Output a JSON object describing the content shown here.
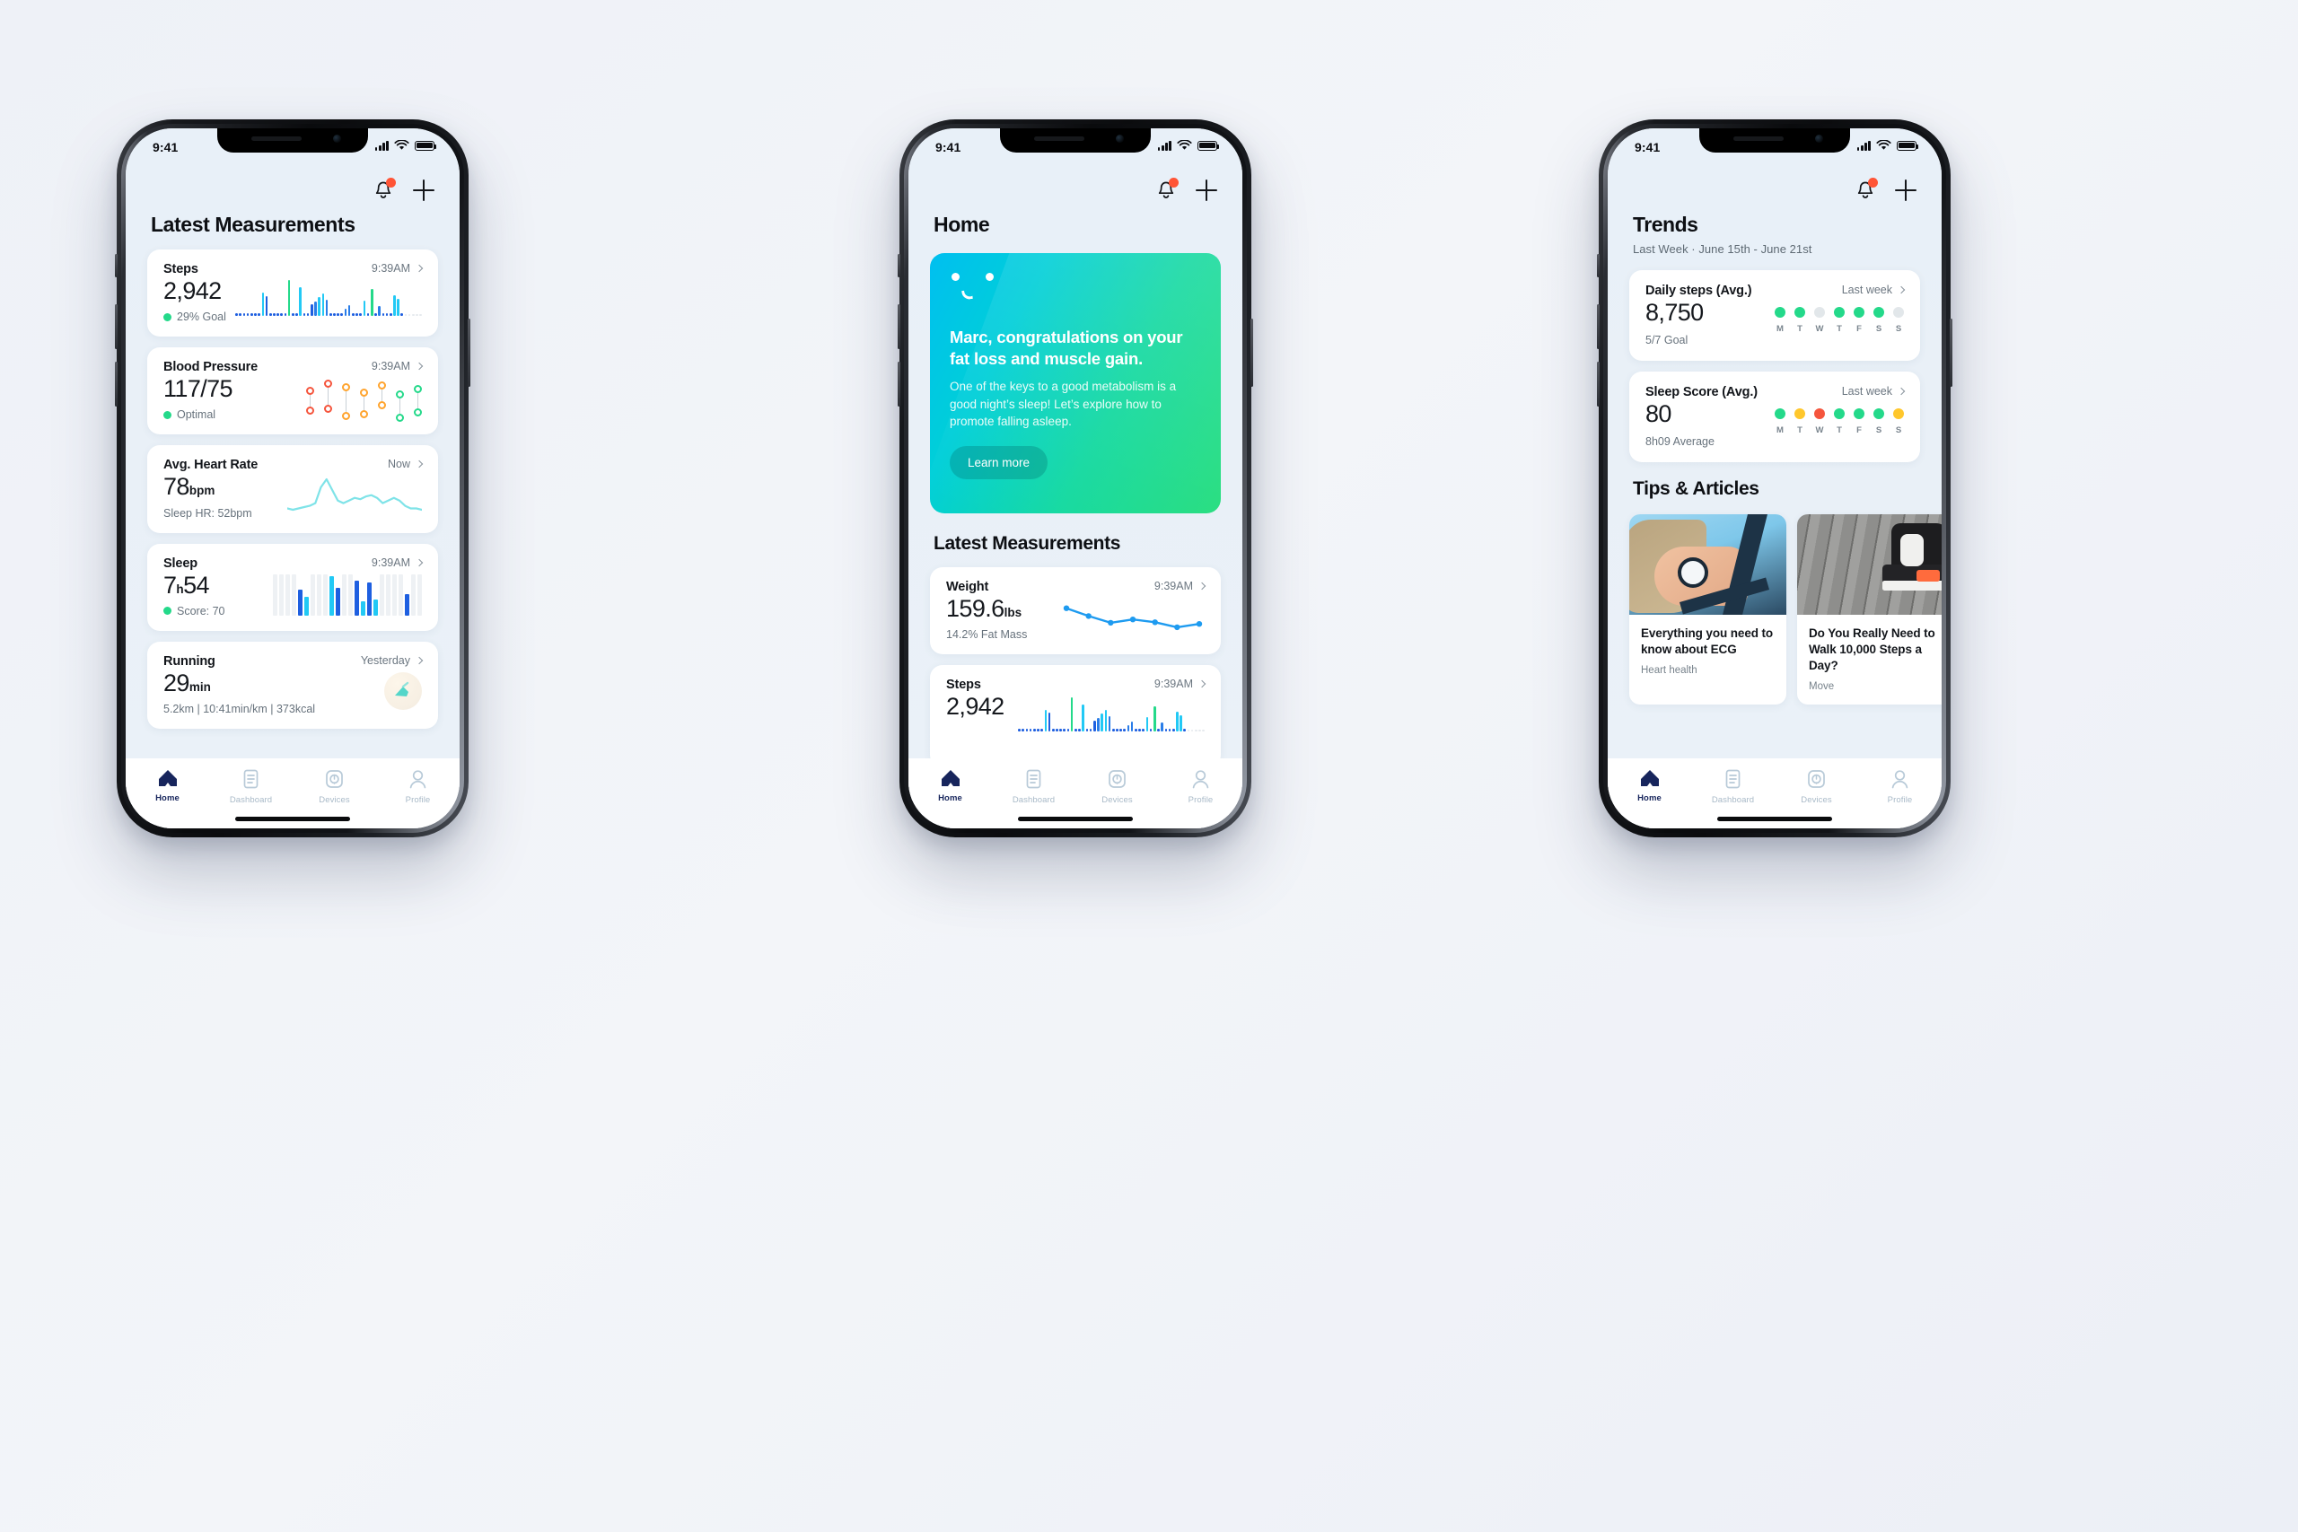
{
  "status_bar": {
    "time": "9:41",
    "signal": "signal-icon",
    "wifi": "wifi-icon",
    "battery": "battery-icon"
  },
  "tabs": [
    {
      "label": "Home",
      "icon": "home-icon",
      "active": true
    },
    {
      "label": "Dashboard",
      "icon": "dashboard-icon",
      "active": false
    },
    {
      "label": "Devices",
      "icon": "watch-icon",
      "active": false
    },
    {
      "label": "Profile",
      "icon": "person-icon",
      "active": false
    }
  ],
  "colors": {
    "accent_green": "#24d98a",
    "accent_blue": "#1e9bf0",
    "accent_cyan": "#22c9f5",
    "accent_yellow": "#ffc72c",
    "accent_red": "#f5553d",
    "accent_orange": "#ffa42e",
    "navy": "#17255c",
    "badge_red": "#ff5436"
  },
  "phone1": {
    "title": "Latest Measurements",
    "cards": [
      {
        "title": "Steps",
        "value": "2,942",
        "unit": "",
        "sub": "29% Goal",
        "sub_dot": "#24d98a",
        "time": "9:39AM",
        "viz": "bars"
      },
      {
        "title": "Blood Pressure",
        "value": "117/75",
        "unit": "",
        "sub": "Optimal",
        "sub_dot": "#24d98a",
        "time": "9:39AM",
        "viz": "bp"
      },
      {
        "title": "Avg. Heart Rate",
        "value": "78",
        "unit": "bpm",
        "sub": "Sleep HR: 52bpm",
        "sub_dot": null,
        "time": "Now",
        "viz": "hr"
      },
      {
        "title": "Sleep",
        "value_a": "7",
        "value_mid": "h",
        "value_b": "54",
        "sub": "Score: 70",
        "sub_dot": "#24d98a",
        "time": "9:39AM",
        "viz": "sleep"
      },
      {
        "title": "Running",
        "value": "29",
        "unit": "min",
        "sub": "5.2km | 10:41min/km | 373kcal",
        "sub_dot": null,
        "time": "Yesterday",
        "viz": "run"
      }
    ]
  },
  "phone2": {
    "title": "Home",
    "banner": {
      "headline": "Marc, congratulations on your fat loss and muscle gain.",
      "body": "One of the keys to a good metabolism is a good night’s sleep! Let’s explore how to promote falling asleep.",
      "cta": "Learn more"
    },
    "section_title": "Latest Measurements",
    "cards": [
      {
        "title": "Weight",
        "value": "159.6",
        "unit": "lbs",
        "sub": "14.2% Fat Mass",
        "time": "9:39AM",
        "viz": "weightline"
      },
      {
        "title": "Steps",
        "value": "2,942",
        "unit": "",
        "sub": "",
        "time": "9:39AM",
        "viz": "bars"
      }
    ]
  },
  "phone3": {
    "title": "Trends",
    "subtitle": "Last Week · June 15th - June 21st",
    "cards": [
      {
        "title": "Daily steps (Avg.)",
        "value": "8,750",
        "sub": "5/7 Goal",
        "link": "Last week",
        "day_labels": [
          "M",
          "T",
          "W",
          "T",
          "F",
          "S",
          "S"
        ],
        "day_colors": [
          "#24d98a",
          "#24d98a",
          "#e2e7ea",
          "#24d98a",
          "#24d98a",
          "#24d98a",
          "#e2e7ea"
        ]
      },
      {
        "title": "Sleep Score (Avg.)",
        "value": "80",
        "sub": "8h09 Average",
        "link": "Last week",
        "day_labels": [
          "M",
          "T",
          "W",
          "T",
          "F",
          "S",
          "S"
        ],
        "day_colors": [
          "#24d98a",
          "#ffc72c",
          "#f5553d",
          "#24d98a",
          "#24d98a",
          "#24d98a",
          "#ffc72c"
        ]
      }
    ],
    "articles_title": "Tips & Articles",
    "articles": [
      {
        "title": "Everything you need to know about ECG",
        "category": "Heart health",
        "image": "watch-on-wrist-photo"
      },
      {
        "title": "Do You Really Need to Walk 10,000 Steps a Day?",
        "category": "Move",
        "image": "sneakers-on-boardwalk-photo"
      }
    ]
  },
  "chart_data": [
    {
      "type": "bar",
      "title": "Steps sparkline",
      "xlabel": "",
      "ylabel": "Steps",
      "values": [
        3,
        3,
        3,
        3,
        3,
        3,
        3,
        26,
        22,
        3,
        3,
        3,
        3,
        3,
        40,
        3,
        3,
        32,
        3,
        3,
        13,
        16,
        21,
        25,
        18,
        3,
        3,
        3,
        3,
        8,
        12,
        3,
        3,
        3,
        17,
        3,
        30,
        3,
        11,
        3,
        3,
        3,
        23,
        19,
        3,
        2,
        2,
        2,
        2,
        2
      ],
      "colors": [
        "#1e5fe0",
        "#1e5fe0",
        "#1e5fe0",
        "#1e5fe0",
        "#1e5fe0",
        "#1e5fe0",
        "#1e5fe0",
        "#22c9f5",
        "#1e5fe0",
        "#1e5fe0",
        "#1e5fe0",
        "#1e5fe0",
        "#1e5fe0",
        "#1e5fe0",
        "#24d98a",
        "#1e5fe0",
        "#1e5fe0",
        "#22c9f5",
        "#1e5fe0",
        "#1e5fe0",
        "#1e5fe0",
        "#2a7de8",
        "#22c9f5",
        "#22c9f5",
        "#2a7de8",
        "#1e5fe0",
        "#1e5fe0",
        "#1e5fe0",
        "#1e5fe0",
        "#2a7de8",
        "#2a7de8",
        "#1e5fe0",
        "#1e5fe0",
        "#1e5fe0",
        "#22c9f5",
        "#1e5fe0",
        "#24d98a",
        "#1e5fe0",
        "#2a7de8",
        "#1e5fe0",
        "#1e5fe0",
        "#1e5fe0",
        "#22c9f5",
        "#22c9f5",
        "#1e5fe0",
        "#e6eaee",
        "#e6eaee",
        "#e6eaee",
        "#e6eaee",
        "#e6eaee"
      ]
    },
    {
      "type": "scatter",
      "title": "Blood pressure readings",
      "xlabel": "",
      "ylabel": "mmHg",
      "points": [
        {
          "top": 10,
          "bottom": 32,
          "color": "#f5553d"
        },
        {
          "top": 2,
          "bottom": 30,
          "color": "#f5553d"
        },
        {
          "top": 6,
          "bottom": 38,
          "color": "#ffa42e"
        },
        {
          "top": 12,
          "bottom": 36,
          "color": "#ffa42e"
        },
        {
          "top": 4,
          "bottom": 26,
          "color": "#ffa42e"
        },
        {
          "top": 14,
          "bottom": 40,
          "color": "#24d98a"
        },
        {
          "top": 8,
          "bottom": 34,
          "color": "#24d98a"
        }
      ]
    },
    {
      "type": "line",
      "title": "Heart rate trace",
      "xlabel": "",
      "ylabel": "bpm",
      "values": [
        26,
        27,
        26,
        25,
        24,
        22,
        10,
        4,
        12,
        20,
        22,
        20,
        18,
        19,
        17,
        16,
        18,
        22,
        20,
        18,
        20,
        24,
        26,
        26,
        27
      ]
    },
    {
      "type": "bar",
      "title": "Sleep stages",
      "xlabel": "",
      "ylabel": "Depth",
      "values": [
        0,
        0,
        0,
        0,
        22,
        16,
        0,
        0,
        0,
        34,
        24,
        0,
        0,
        30,
        12,
        28,
        14,
        0,
        0,
        0,
        0,
        18,
        0,
        0
      ],
      "colors": [
        "#eef1f4",
        "#eef1f4",
        "#eef1f4",
        "#eef1f4",
        "#1e5fe0",
        "#22c9f5",
        "#eef1f4",
        "#eef1f4",
        "#eef1f4",
        "#22c9f5",
        "#1e5fe0",
        "#eef1f4",
        "#eef1f4",
        "#1e5fe0",
        "#22c9f5",
        "#1e5fe0",
        "#22c9f5",
        "#eef1f4",
        "#eef1f4",
        "#eef1f4",
        "#eef1f4",
        "#1e5fe0",
        "#eef1f4",
        "#eef1f4"
      ]
    },
    {
      "type": "line",
      "title": "Weight trend",
      "xlabel": "",
      "ylabel": "lbs",
      "values": [
        162.4,
        161.0,
        159.8,
        160.4,
        159.9,
        159.0,
        159.6
      ],
      "ylim": [
        158.5,
        163.0
      ]
    }
  ]
}
